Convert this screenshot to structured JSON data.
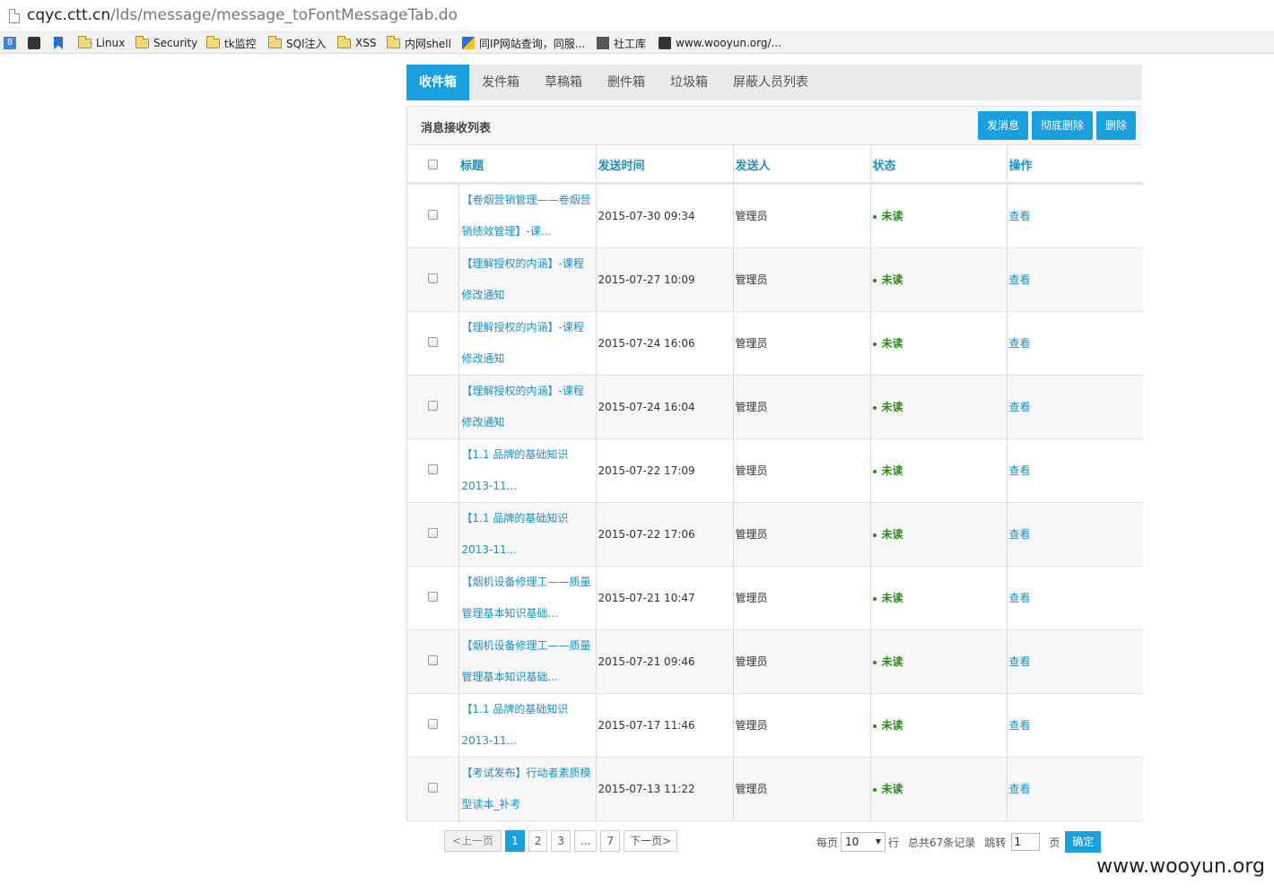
{
  "browser": {
    "url_host": "cqyc.ctt.cn",
    "url_path": "/lds/message/message_toFontMessageTab.do",
    "bookmarks": [
      "Linux",
      "Security",
      "tk监控",
      "SQl注入",
      "XSS",
      "内网shell",
      "同IP网站查询，同服...",
      "社工库",
      "www.wooyun.org/..."
    ]
  },
  "tabs": [
    "收件箱",
    "发件箱",
    "草稿箱",
    "删件箱",
    "垃圾箱",
    "屏蔽人员列表"
  ],
  "panel": {
    "title": "消息接收列表",
    "buttons": [
      "发消息",
      "彻底删除",
      "删除"
    ]
  },
  "table": {
    "headers": [
      "标题",
      "发送时间",
      "发送人",
      "状态",
      "操作"
    ],
    "rows": [
      {
        "title1": "【卷烟营销管理——卷烟营",
        "title2": "销绩效管理】-课...",
        "time": "2015-07-30 09:34",
        "sender": "管理员",
        "status": "未读",
        "op": "查看"
      },
      {
        "title1": "【理解授权的内涵】-课程",
        "title2": "修改通知",
        "time": "2015-07-27 10:09",
        "sender": "管理员",
        "status": "未读",
        "op": "查看"
      },
      {
        "title1": "【理解授权的内涵】-课程",
        "title2": "修改通知",
        "time": "2015-07-24 16:06",
        "sender": "管理员",
        "status": "未读",
        "op": "查看"
      },
      {
        "title1": "【理解授权的内涵】-课程",
        "title2": "修改通知",
        "time": "2015-07-24 16:04",
        "sender": "管理员",
        "status": "未读",
        "op": "查看"
      },
      {
        "title1": "【1.1 品牌的基础知识",
        "title2": "2013-11...",
        "time": "2015-07-22 17:09",
        "sender": "管理员",
        "status": "未读",
        "op": "查看"
      },
      {
        "title1": "【1.1 品牌的基础知识",
        "title2": "2013-11...",
        "time": "2015-07-22 17:06",
        "sender": "管理员",
        "status": "未读",
        "op": "查看"
      },
      {
        "title1": "【烟机设备修理工——质量",
        "title2": "管理基本知识基础...",
        "time": "2015-07-21 10:47",
        "sender": "管理员",
        "status": "未读",
        "op": "查看"
      },
      {
        "title1": "【烟机设备修理工——质量",
        "title2": "管理基本知识基础...",
        "time": "2015-07-21 09:46",
        "sender": "管理员",
        "status": "未读",
        "op": "查看"
      },
      {
        "title1": "【1.1 品牌的基础知识",
        "title2": "2013-11...",
        "time": "2015-07-17 11:46",
        "sender": "管理员",
        "status": "未读",
        "op": "查看"
      },
      {
        "title1": "【考试发布】行动者素质模",
        "title2": "型读本_补考",
        "time": "2015-07-13 11:22",
        "sender": "管理员",
        "status": "未读",
        "op": "查看"
      }
    ]
  },
  "pagination": {
    "prev": "<上一页",
    "pages": [
      "1",
      "2",
      "3",
      "...",
      "7"
    ],
    "next": "下一页>",
    "per_page_label": "每页",
    "per_page_value": "10",
    "row_label": "行",
    "total": "总共67条记录",
    "jump_label": "跳转",
    "jump_value": "1",
    "page_unit": "页",
    "confirm": "确定"
  },
  "watermark": "www.wooyun.org"
}
